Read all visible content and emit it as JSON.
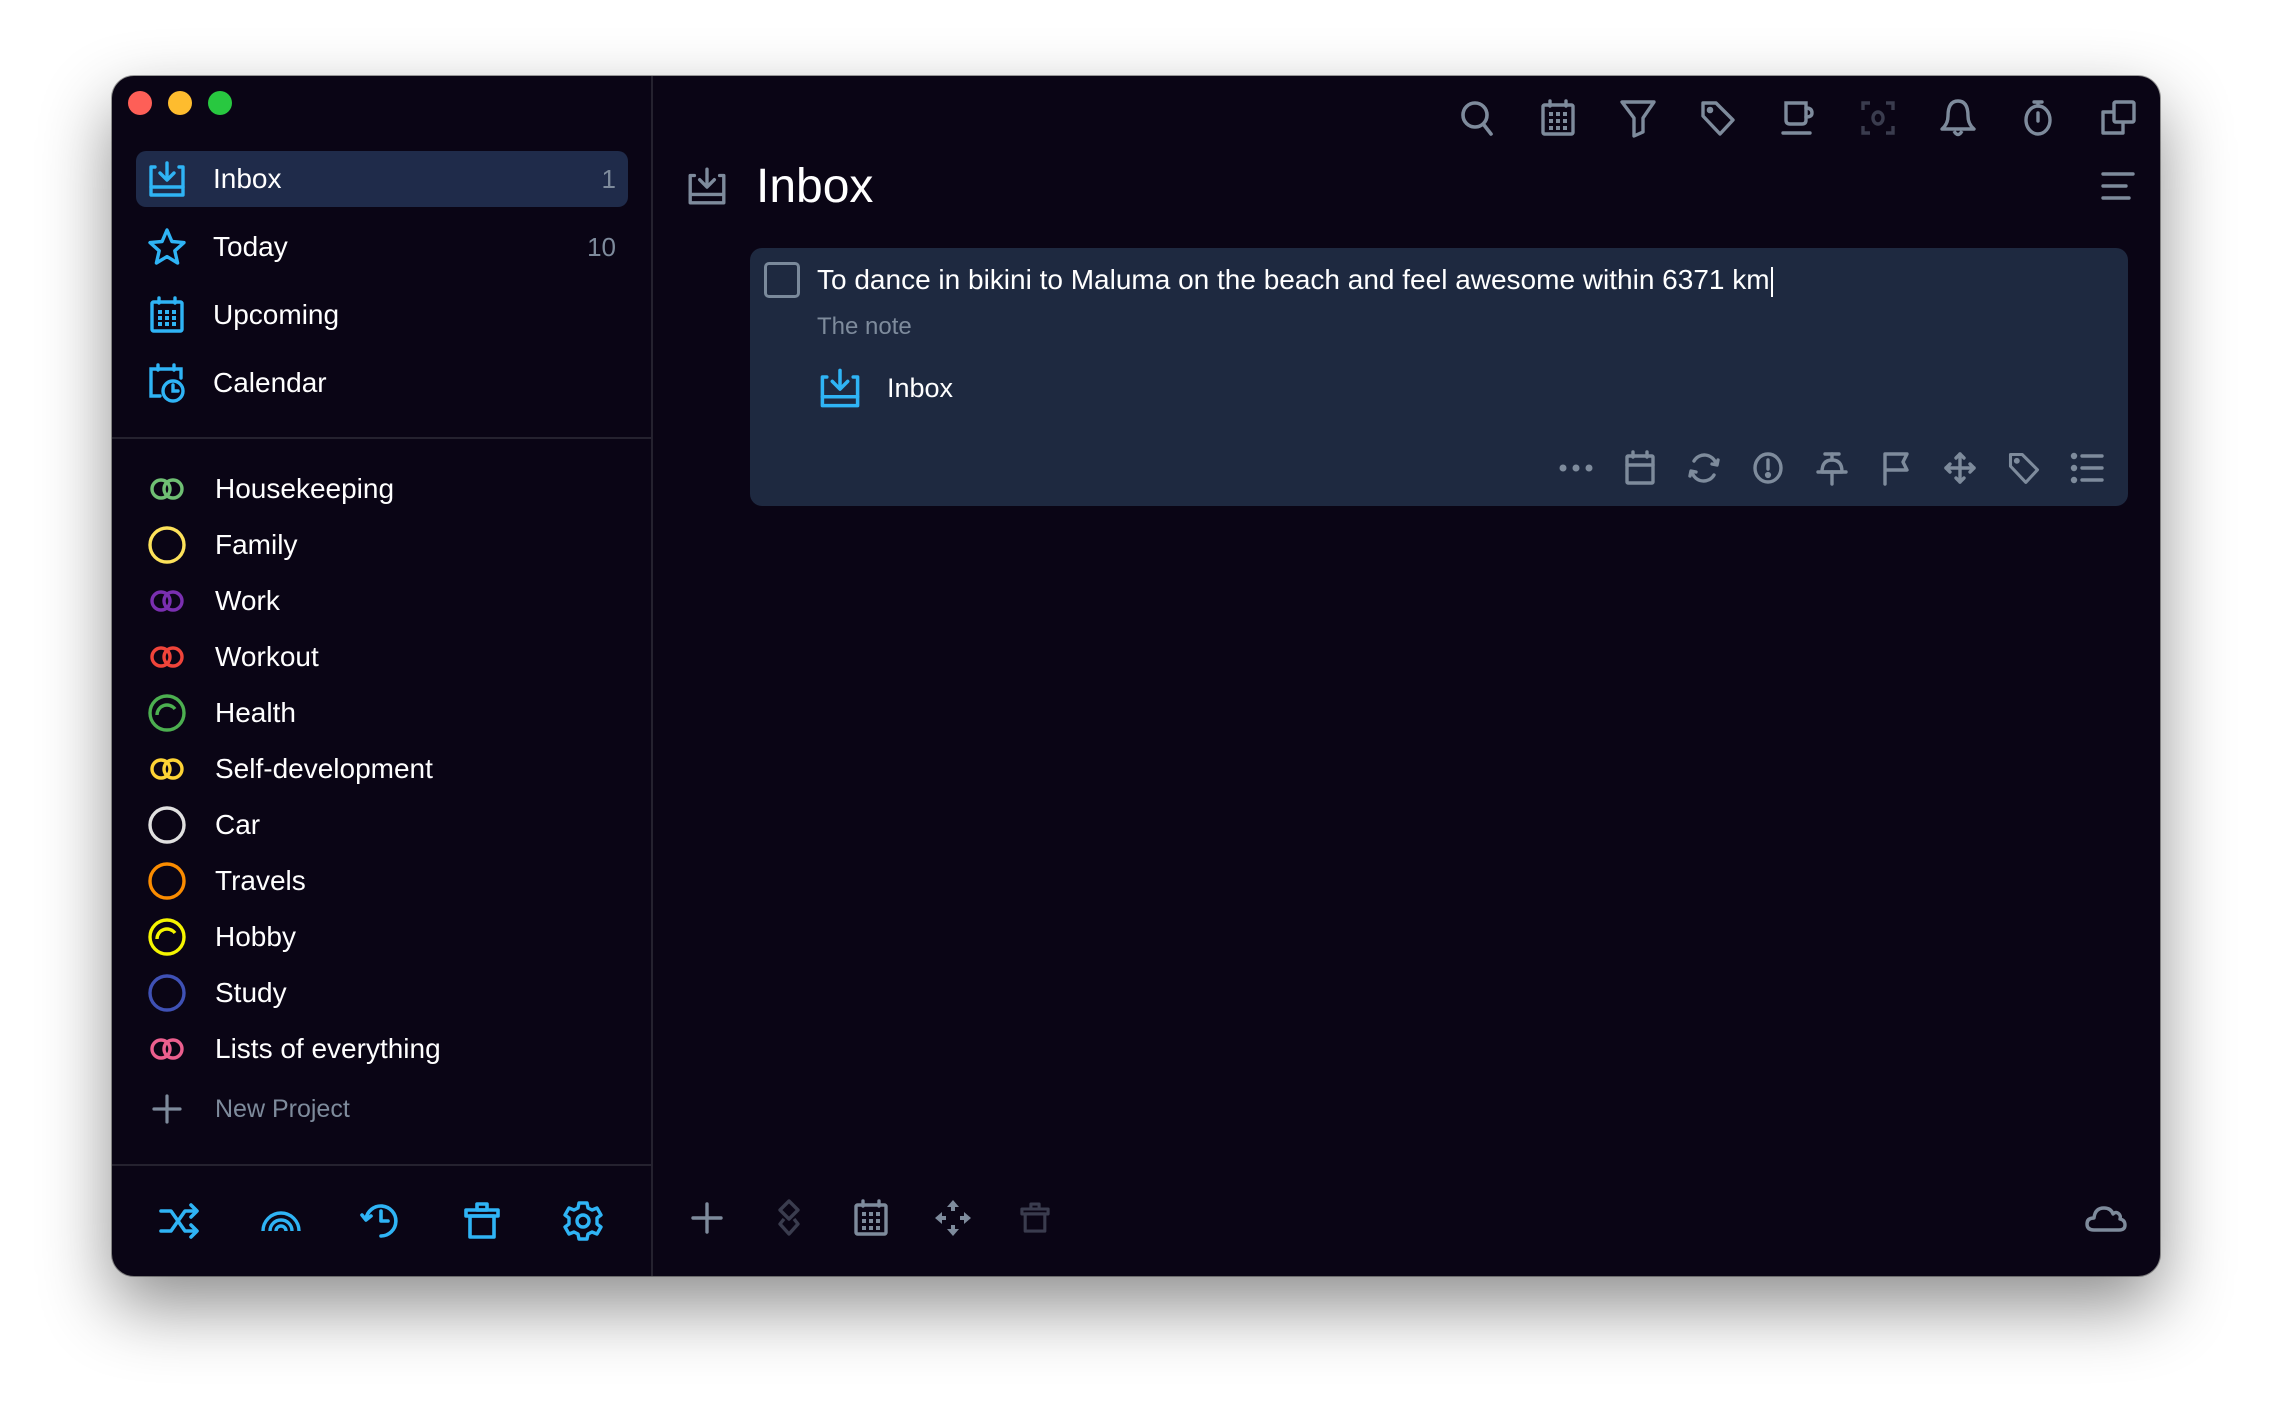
{
  "window": {
    "title": "Inbox"
  },
  "colors": {
    "accent": "#2fb4f5",
    "window_bg": "#0a0515",
    "card_bg": "#1e2940",
    "active_item_bg": "#1f2b4a",
    "muted": "#7e8b9c",
    "disabled": "#3a3c4e"
  },
  "sidebar": {
    "nav": [
      {
        "label": "Inbox",
        "count": "1",
        "icon": "inbox-icon",
        "active": true
      },
      {
        "label": "Today",
        "count": "10",
        "icon": "star-icon",
        "active": false
      },
      {
        "label": "Upcoming",
        "count": "",
        "icon": "calendar-grid-icon",
        "active": false
      },
      {
        "label": "Calendar",
        "count": "",
        "icon": "calendar-clock-icon",
        "active": false
      }
    ],
    "projects": [
      {
        "label": "Housekeeping",
        "color": "#6fbf73",
        "icon": "double-ring-icon"
      },
      {
        "label": "Family",
        "color": "#fde25a",
        "icon": "ring-icon"
      },
      {
        "label": "Work",
        "color": "#7a2fb0",
        "icon": "double-ring-icon"
      },
      {
        "label": "Workout",
        "color": "#f0443a",
        "icon": "double-ring-icon"
      },
      {
        "label": "Health",
        "color": "#4caf50",
        "icon": "progress-ring-icon"
      },
      {
        "label": "Self-development",
        "color": "#fdd335",
        "icon": "double-ring-icon"
      },
      {
        "label": "Car",
        "color": "#e0e0e0",
        "icon": "ring-icon"
      },
      {
        "label": "Travels",
        "color": "#fb8c00",
        "icon": "ring-icon"
      },
      {
        "label": "Hobby",
        "color": "#f5f500",
        "icon": "progress-ring-icon"
      },
      {
        "label": "Study",
        "color": "#3f51b5",
        "icon": "ring-icon"
      },
      {
        "label": "Lists of everything",
        "color": "#ec5f8e",
        "icon": "double-ring-icon"
      }
    ],
    "new_project_label": "New Project",
    "toolbar": [
      {
        "name": "shuffle",
        "icon": "shuffle-icon"
      },
      {
        "name": "rainbow",
        "icon": "rainbow-icon"
      },
      {
        "name": "history",
        "icon": "history-icon"
      },
      {
        "name": "trash",
        "icon": "trash-icon"
      },
      {
        "name": "settings",
        "icon": "gear-icon"
      }
    ]
  },
  "main": {
    "top_toolbar": [
      {
        "name": "search",
        "icon": "search-icon"
      },
      {
        "name": "calendar",
        "icon": "calendar-icon"
      },
      {
        "name": "filter",
        "icon": "filter-icon"
      },
      {
        "name": "tags",
        "icon": "tag-icon"
      },
      {
        "name": "coffee-break",
        "icon": "coffee-icon"
      },
      {
        "name": "focus",
        "icon": "focus-icon"
      },
      {
        "name": "notifications",
        "icon": "bell-icon"
      },
      {
        "name": "timer",
        "icon": "stopwatch-icon"
      },
      {
        "name": "duplicate-window",
        "icon": "copy-icon"
      }
    ],
    "header": {
      "title": "Inbox",
      "icon": "inbox-icon"
    },
    "task": {
      "title": "To dance in bikini to Maluma on the beach and feel awesome within 6371 km",
      "note_placeholder": "The note",
      "project": "Inbox",
      "completed": false,
      "actions": [
        {
          "name": "more",
          "icon": "more-icon"
        },
        {
          "name": "date",
          "icon": "calendar-icon"
        },
        {
          "name": "repeat",
          "icon": "repeat-icon"
        },
        {
          "name": "priority",
          "icon": "priority-icon"
        },
        {
          "name": "pin",
          "icon": "pin-icon"
        },
        {
          "name": "flag",
          "icon": "flag-icon"
        },
        {
          "name": "move",
          "icon": "move-icon"
        },
        {
          "name": "tags",
          "icon": "tag-icon"
        },
        {
          "name": "checklist",
          "icon": "checklist-icon"
        }
      ]
    },
    "bottom_toolbar": [
      {
        "name": "add-task",
        "icon": "plus-icon",
        "enabled": true
      },
      {
        "name": "layers",
        "icon": "layers-icon",
        "enabled": false
      },
      {
        "name": "schedule",
        "icon": "calendar-icon",
        "enabled": true
      },
      {
        "name": "move",
        "icon": "move-arrows-icon",
        "enabled": true
      },
      {
        "name": "delete",
        "icon": "trash-icon",
        "enabled": false
      }
    ],
    "sync": {
      "icon": "cloud-icon"
    }
  }
}
